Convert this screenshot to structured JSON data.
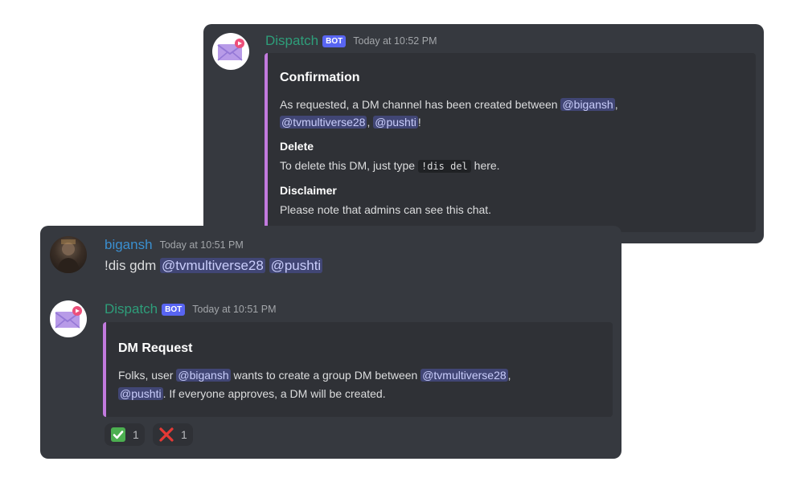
{
  "top_message": {
    "author": "Dispatch",
    "badge": "BOT",
    "timestamp": "Today at 10:52 PM",
    "embed": {
      "title": "Confirmation",
      "desc_before": "As requested, a DM channel has been created between",
      "mention1": "@bigansh",
      "comma1": ",",
      "mention2": "@tvmultiverse28",
      "comma2": ",",
      "mention3": "@pushti",
      "exclaim": "!",
      "field1_name": "Delete",
      "field1_before": "To delete this DM, just type",
      "field1_code": "!dis del",
      "field1_after": "here.",
      "field2_name": "Disclaimer",
      "field2_value": "Please note that admins can see this chat."
    }
  },
  "user_message": {
    "author": "bigansh",
    "timestamp": "Today at 10:51 PM",
    "text": "!dis gdm",
    "mention1": "@tvmultiverse28",
    "mention2": "@pushti"
  },
  "bot_message": {
    "author": "Dispatch",
    "badge": "BOT",
    "timestamp": "Today at 10:51 PM",
    "embed": {
      "title": "DM Request",
      "line1_before": "Folks, user",
      "line1_mention": "@bigansh",
      "line1_middle": "wants to create a group DM between",
      "line1_mention2": "@tvmultiverse28",
      "line1_comma": ",",
      "line2_mention": "@pushti",
      "line2_after": ". If everyone approves, a DM will be created."
    },
    "reactions": [
      {
        "emoji": "check-mark-icon",
        "count": "1"
      },
      {
        "emoji": "cross-mark-icon",
        "count": "1"
      }
    ]
  },
  "colors": {
    "panel_bg": "#36393f",
    "embed_bg": "#2f3136",
    "embed_accent": "#c27ade",
    "bot_name": "#2e9e7a",
    "user_name": "#3a8fd0",
    "bot_badge": "#5865f2",
    "mention_bg": "#414675"
  }
}
